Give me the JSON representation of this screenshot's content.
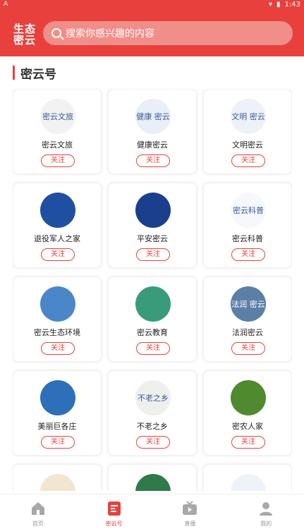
{
  "statusbar": {
    "left_icon": "A",
    "time": "1:43"
  },
  "header": {
    "logo_line1": "生态",
    "logo_line2": "密云",
    "search_placeholder": "搜索你感兴趣的内容"
  },
  "section_title": "密云号",
  "accounts": [
    {
      "name": "密云文旅",
      "follow": "关注",
      "avatar_text": "密云文旅",
      "color": "#f2f2f2"
    },
    {
      "name": "健康密云",
      "follow": "关注",
      "avatar_text": "健康 密云",
      "color": "#e9eef7"
    },
    {
      "name": "文明密云",
      "follow": "关注",
      "avatar_text": "文明 密云",
      "color": "#eef2f8"
    },
    {
      "name": "退役军人之家",
      "follow": "关注",
      "avatar_text": "",
      "color": "#1f4fa3"
    },
    {
      "name": "平安密云",
      "follow": "关注",
      "avatar_text": "",
      "color": "#1a3f8c"
    },
    {
      "name": "密云科普",
      "follow": "关注",
      "avatar_text": "密云科普",
      "color": "#f6f8fb"
    },
    {
      "name": "密云生态环境",
      "follow": "关注",
      "avatar_text": "",
      "color": "#4b86c9"
    },
    {
      "name": "密云教育",
      "follow": "关注",
      "avatar_text": "",
      "color": "#3a9b7b"
    },
    {
      "name": "法润密云",
      "follow": "关注",
      "avatar_text": "法润 密云",
      "color": "#5b7fa6"
    },
    {
      "name": "美丽巨各庄",
      "follow": "关注",
      "avatar_text": "",
      "color": "#2d6fb8"
    },
    {
      "name": "不老之乡",
      "follow": "关注",
      "avatar_text": "不老之乡",
      "color": "#eef0ec"
    },
    {
      "name": "密农人家",
      "follow": "关注",
      "avatar_text": "",
      "color": "#4f8a2e"
    },
    {
      "name": "",
      "follow": "",
      "avatar_text": "",
      "color": "#f3e6d0"
    },
    {
      "name": "",
      "follow": "",
      "avatar_text": "",
      "color": "#2f7a4a"
    },
    {
      "name": "",
      "follow": "",
      "avatar_text": "",
      "color": "#eef3fa"
    }
  ],
  "tabs": [
    {
      "label": "首页",
      "icon": "home-icon"
    },
    {
      "label": "密云号",
      "icon": "document-icon"
    },
    {
      "label": "直播",
      "icon": "tv-icon"
    },
    {
      "label": "我的",
      "icon": "user-icon"
    }
  ],
  "colors": {
    "accent": "#e8413d"
  }
}
